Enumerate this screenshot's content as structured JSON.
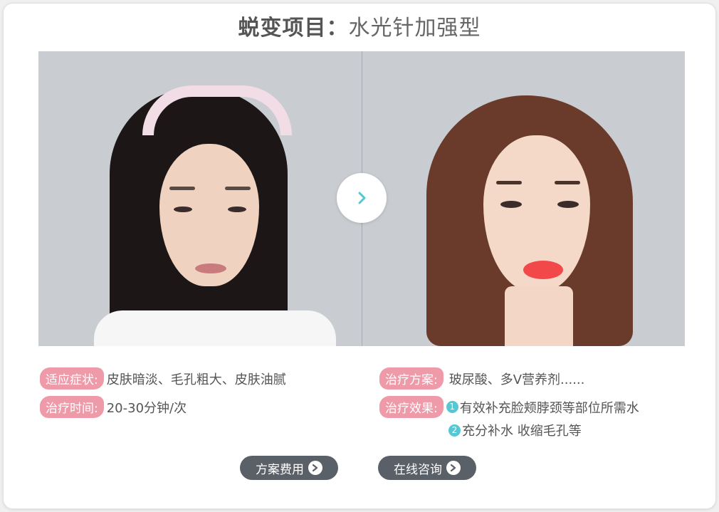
{
  "title": {
    "bold": "蜕变项目：",
    "rest": "水光针加强型"
  },
  "colors": {
    "tag": "#ee9aa8",
    "accent": "#55c8d4",
    "button": "#5a6068",
    "panel": "#c9ccd1"
  },
  "next_button": {
    "icon": "chevron-right-icon"
  },
  "left_info": [
    {
      "label": "适应症状:",
      "value": "皮肤暗淡、毛孔粗大、皮肤油腻"
    },
    {
      "label": "治疗时间:",
      "value": "20-30分钟/次"
    }
  ],
  "right_info": {
    "plan": {
      "label": "治疗方案:",
      "value": "玻尿酸、多V营养剂......"
    },
    "effect": {
      "label": "治疗效果:",
      "items": [
        {
          "num": "1",
          "text": "有效补充脸颊脖颈等部位所需水"
        },
        {
          "num": "2",
          "text": "充分补水 收缩毛孔等"
        }
      ]
    }
  },
  "buttons": [
    {
      "label": "方案费用",
      "icon": "arrow-right-icon"
    },
    {
      "label": "在线咨询",
      "icon": "arrow-right-icon"
    }
  ]
}
